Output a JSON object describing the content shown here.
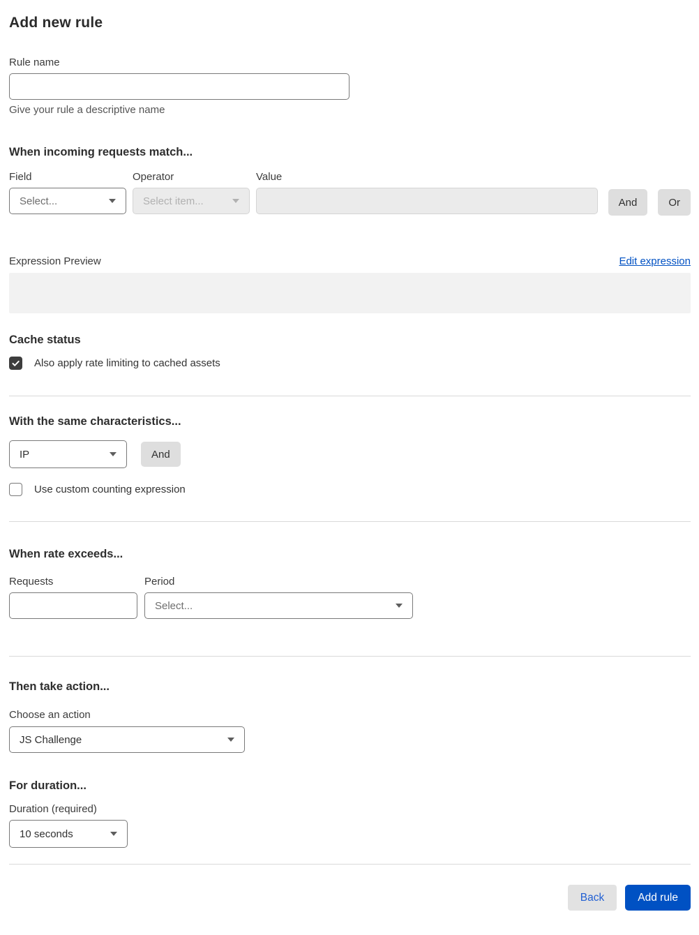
{
  "page": {
    "title": "Add new rule"
  },
  "rule_name": {
    "label": "Rule name",
    "value": "",
    "helper": "Give your rule a descriptive name"
  },
  "match_section": {
    "heading": "When incoming requests match...",
    "field": {
      "label": "Field",
      "selected": "Select..."
    },
    "operator": {
      "label": "Operator",
      "selected": "Select item...",
      "disabled": true
    },
    "value": {
      "label": "Value",
      "value": "",
      "disabled": true
    },
    "and_button": "And",
    "or_button": "Or",
    "expression_preview_label": "Expression Preview",
    "edit_expression_link": "Edit expression",
    "expression_value": ""
  },
  "cache_status": {
    "heading": "Cache status",
    "checkbox_label": "Also apply rate limiting to cached assets",
    "checked": true
  },
  "characteristics": {
    "heading": "With the same characteristics...",
    "selected": "IP",
    "and_button": "And",
    "checkbox_label": "Use custom counting expression",
    "checked": false
  },
  "rate": {
    "heading": "When rate exceeds...",
    "requests": {
      "label": "Requests",
      "value": ""
    },
    "period": {
      "label": "Period",
      "selected": "Select..."
    }
  },
  "action": {
    "heading": "Then take action...",
    "label": "Choose an action",
    "selected": "JS Challenge"
  },
  "duration": {
    "heading": "For duration...",
    "label": "Duration (required)",
    "selected": "10 seconds"
  },
  "footer": {
    "back_button": "Back",
    "add_rule_button": "Add rule"
  },
  "icons": {
    "dropdown_chevron": "chevron-down-icon",
    "checkmark": "check-icon"
  },
  "colors": {
    "accent_blue": "#0051c3",
    "text_dark": "#313131",
    "divider": "#d9d9d9",
    "disabled_bg": "#ebebeb",
    "checkbox_checked": "#3d3d3d",
    "preview_bg": "#f2f2f2",
    "gray_button_bg": "#dedede"
  }
}
